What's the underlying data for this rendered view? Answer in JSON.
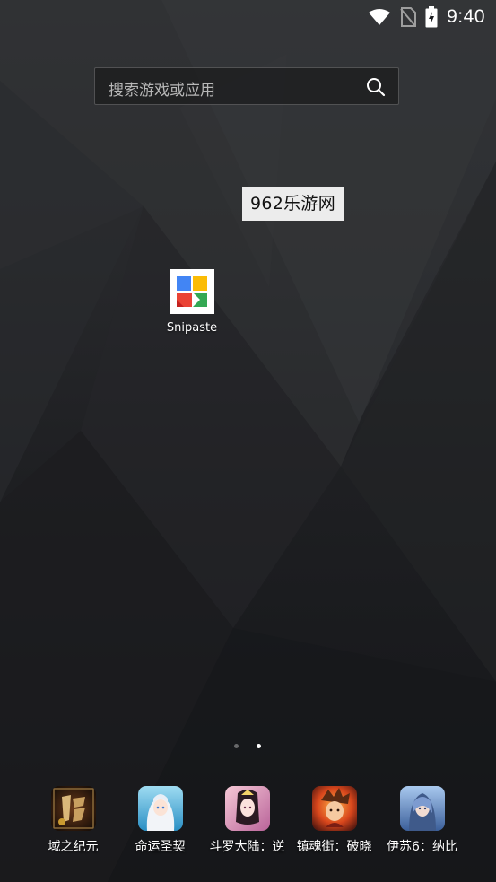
{
  "status_bar": {
    "time": "9:40",
    "icons": [
      "wifi-icon",
      "no-sim-icon",
      "battery-charging-icon"
    ]
  },
  "search": {
    "placeholder": "搜索游戏或应用",
    "icon": "search-icon"
  },
  "watermark": {
    "text": "962乐游网"
  },
  "desktop_apps": [
    {
      "label": "Snipaste",
      "icon": "snipaste-icon"
    }
  ],
  "page_indicator": {
    "pages": 2,
    "current": 2
  },
  "dock": {
    "items": [
      {
        "label": "域之纪元",
        "icon": "yuzhijiyuan-game-icon"
      },
      {
        "label": "命运圣契",
        "icon": "mingyunshengqi-game-icon"
      },
      {
        "label": "斗罗大陆：逆",
        "icon": "douluodalu-game-icon"
      },
      {
        "label": "镇魂街：破晓",
        "icon": "zhenhunjie-game-icon"
      },
      {
        "label": "伊苏6：纳比",
        "icon": "yisu6-game-icon"
      }
    ]
  },
  "colors": {
    "wallpaper_dark": "#18191c",
    "wallpaper_light": "#2e2f32",
    "search_border": "#3a3a3c",
    "watermark_bg": "#ececec",
    "snipaste_blue": "#4285f4",
    "snipaste_yellow": "#fbbc05",
    "snipaste_red": "#ea4335",
    "snipaste_green": "#34a853"
  }
}
